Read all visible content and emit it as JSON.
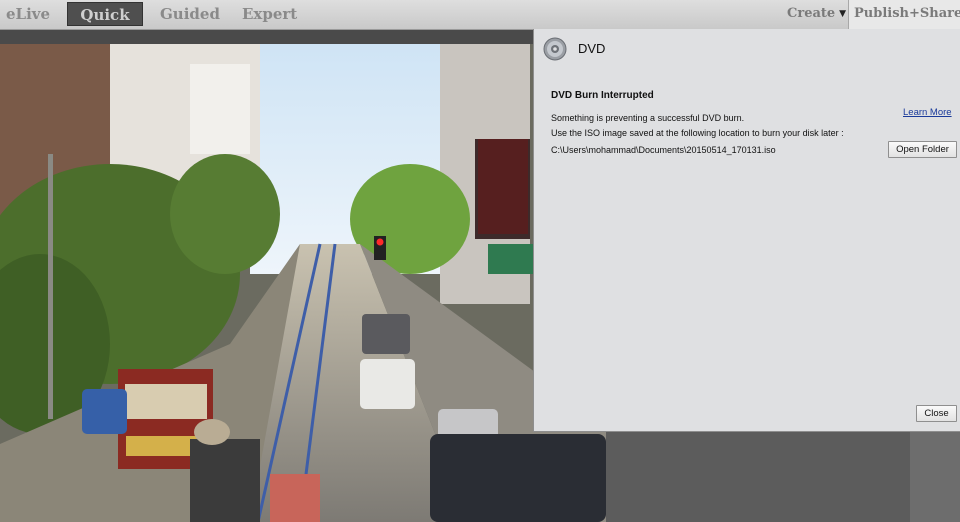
{
  "topbar": {
    "tabs": [
      {
        "label": "eLive"
      },
      {
        "label": "Quick",
        "active": true
      },
      {
        "label": "Guided"
      },
      {
        "label": "Expert"
      }
    ],
    "create_label": "Create",
    "publish_label": "Publish+Share"
  },
  "dialog": {
    "title": "DVD",
    "headline": "DVD Burn Interrupted",
    "message": "Something is preventing a successful DVD burn.",
    "instruction": "Use the ISO image saved at the following location to burn your disk later :",
    "path": "C:\\Users\\mohammad\\Documents\\20150514_170131.iso",
    "learn_more": "Learn More",
    "open_folder": "Open Folder",
    "close": "Close"
  },
  "icons": {
    "create_caret": "caret-down-icon",
    "publish_caret": "caret-down-icon",
    "dvd": "dvd-disc-icon"
  },
  "colors": {
    "panel_bg": "#dfe0e2",
    "link": "#1a3a9a",
    "active_tab_bg": "#4f4f4f"
  }
}
